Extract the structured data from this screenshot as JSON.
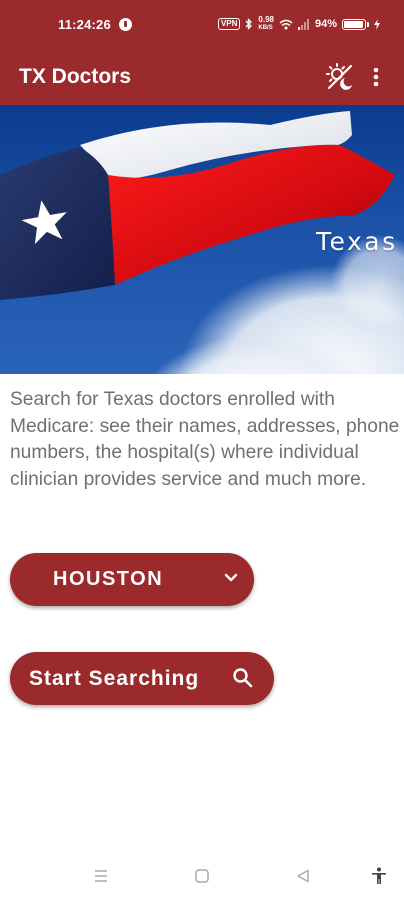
{
  "status_bar": {
    "time": "11:24:26",
    "vpn": "VPN",
    "speed_top": "0.98",
    "speed_unit": "KB/S",
    "battery": "94%",
    "battery_level": 0.94
  },
  "app_bar": {
    "title": "TX Doctors",
    "theme_icon": "brightness-toggle-icon",
    "menu_icon": "more-vert-icon"
  },
  "hero": {
    "label": "Texas"
  },
  "description": "Search for Texas doctors enrolled with Medicare: see their names, addresses, phone numbers, the hospital(s) where individual clinician provides service and much more.",
  "city_select": {
    "value": "HOUSTON"
  },
  "search_button": {
    "label": "Start Searching"
  },
  "colors": {
    "primary": "#9b2a2c",
    "text_muted": "#707070",
    "background": "#ffffff"
  },
  "nav_bar": {
    "icons": [
      "recents-icon",
      "home-icon",
      "back-icon",
      "accessibility-icon"
    ]
  }
}
